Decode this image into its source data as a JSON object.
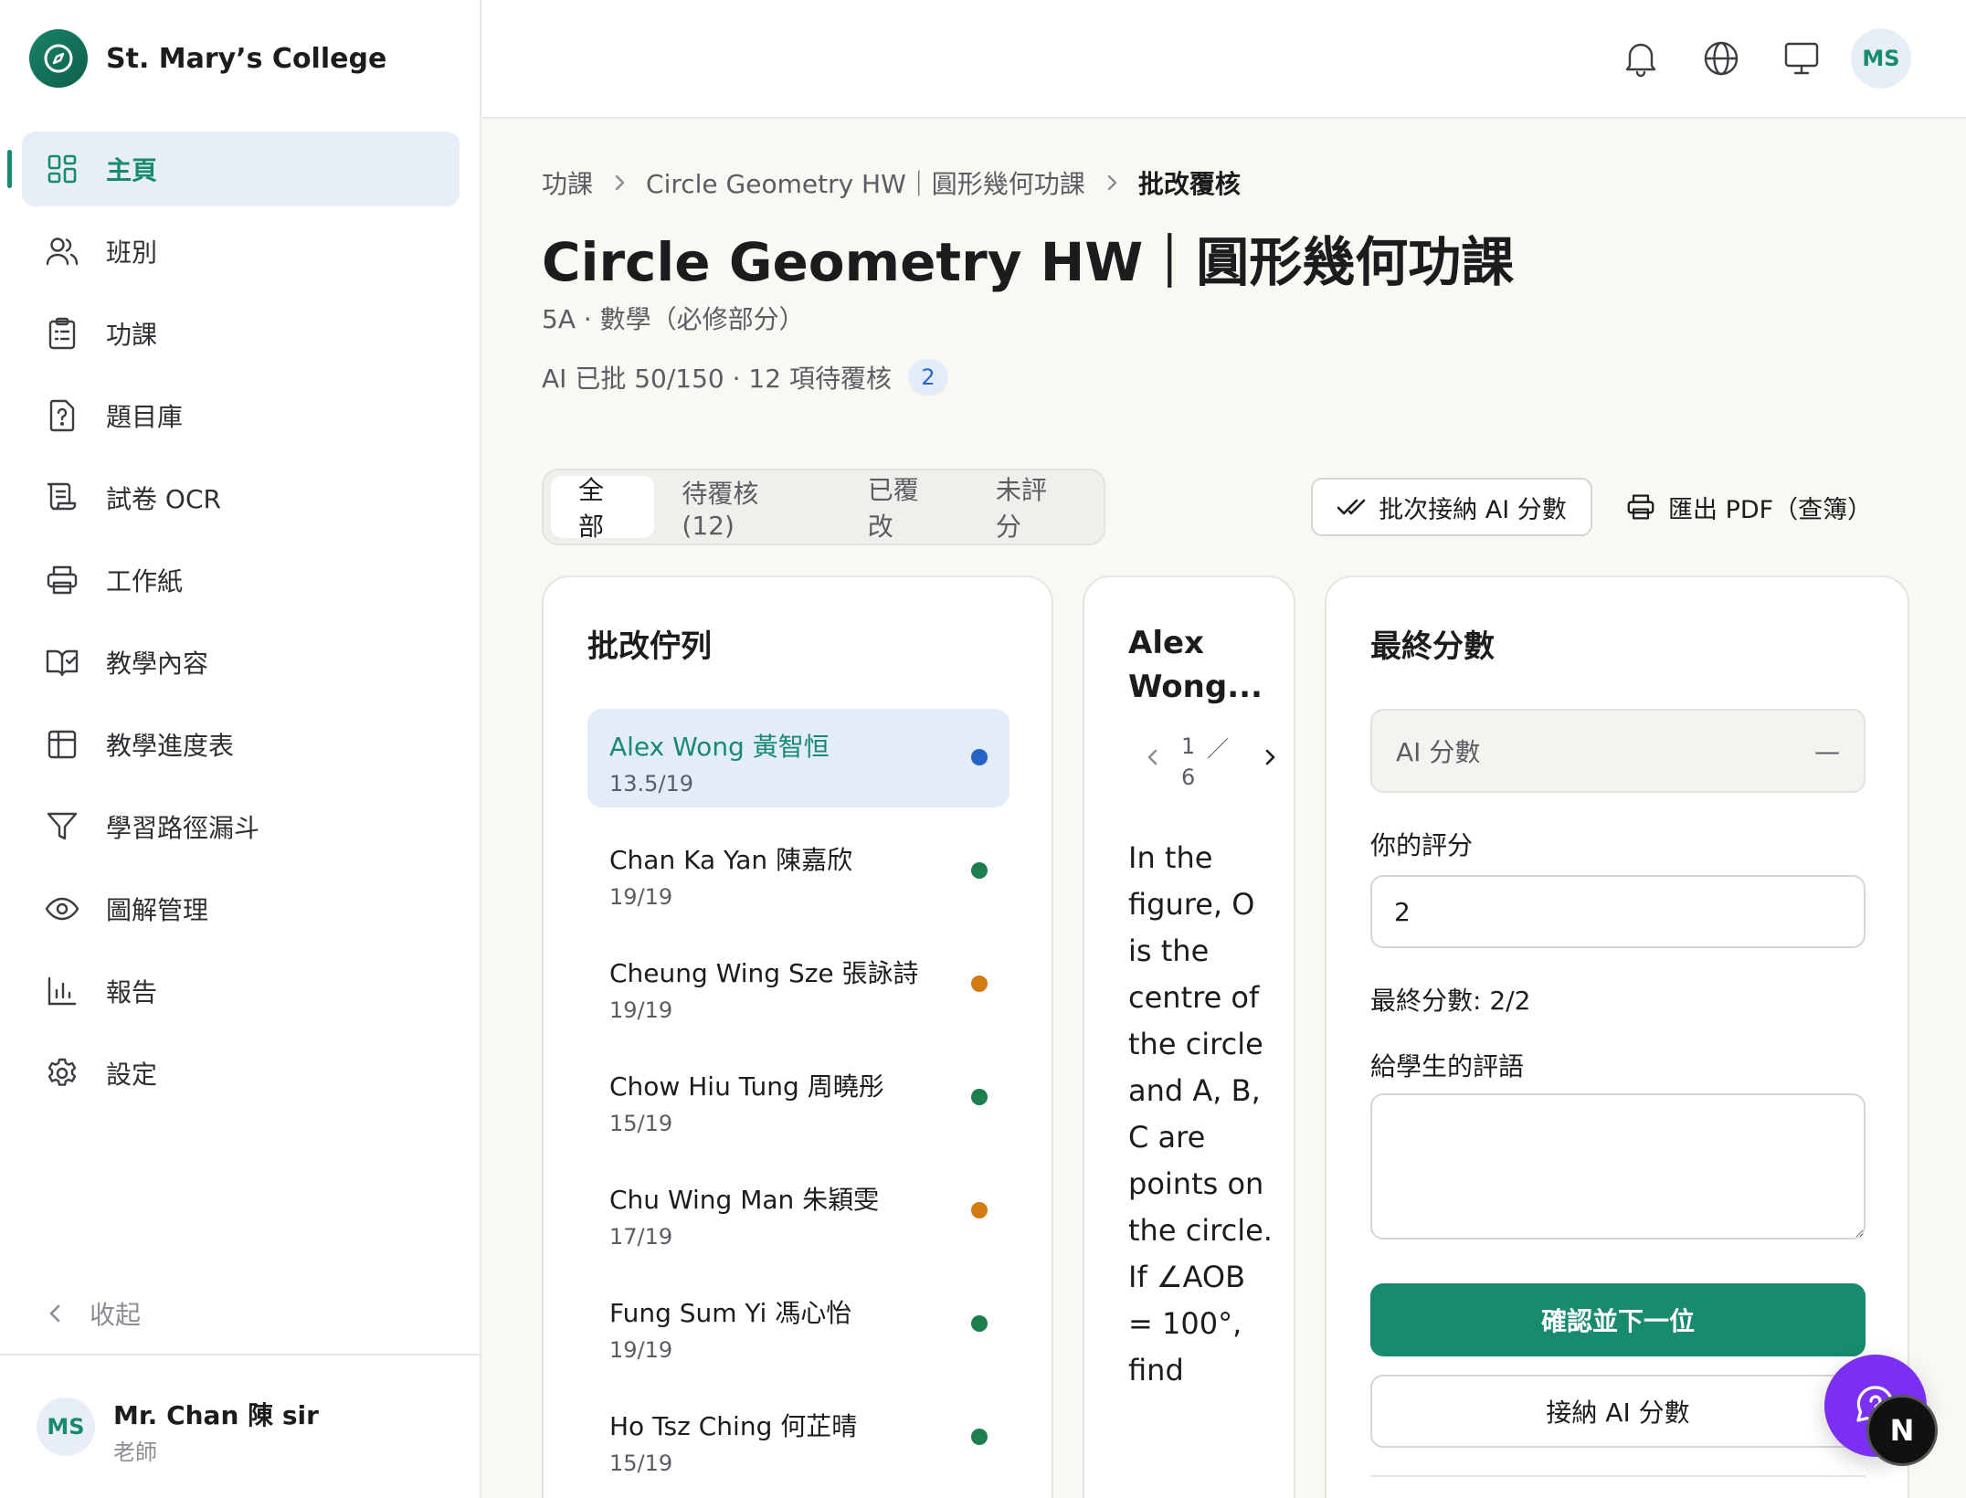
{
  "brand": {
    "name": "St. Mary’s College"
  },
  "sidebar": {
    "items": [
      {
        "label": "主頁",
        "icon": "dashboard-icon",
        "active": true
      },
      {
        "label": "班別",
        "icon": "users-icon"
      },
      {
        "label": "功課",
        "icon": "clipboard-list-icon"
      },
      {
        "label": "題目庫",
        "icon": "question-file-icon"
      },
      {
        "label": "試卷 OCR",
        "icon": "scroll-icon"
      },
      {
        "label": "工作紙",
        "icon": "printer-icon"
      },
      {
        "label": "教學內容",
        "icon": "book-open-check-icon"
      },
      {
        "label": "教學進度表",
        "icon": "table-icon"
      },
      {
        "label": "學習路徑漏斗",
        "icon": "funnel-icon"
      },
      {
        "label": "圖解管理",
        "icon": "eye-icon"
      },
      {
        "label": "報告",
        "icon": "bar-chart-icon"
      },
      {
        "label": "設定",
        "icon": "gear-icon"
      }
    ],
    "collapse_label": "收起"
  },
  "user": {
    "initials": "MS",
    "name": "Mr. Chan 陳 sir",
    "role": "老師"
  },
  "header": {
    "avatar_initials": "MS",
    "icons": [
      "bell-icon",
      "globe-icon",
      "monitor-icon"
    ]
  },
  "breadcrumb": {
    "home": "功課",
    "assignment": "Circle Geometry HW｜圓形幾何功課",
    "current": "批改覆核"
  },
  "page": {
    "title": "Circle Geometry HW｜圓形幾何功課",
    "subtitle": "5A · 數學（必修部分）",
    "progress": "AI 已批 50/150 · 12 項待覆核",
    "badge": "2"
  },
  "tabs": [
    "全部",
    "待覆核 (12)",
    "已覆改",
    "未評分"
  ],
  "actions": {
    "batch_accept": "批次接納 AI 分數",
    "export_pdf": "匯出 PDF（查簿）"
  },
  "queue": {
    "title": "批改佇列",
    "items": [
      {
        "name": "Alex Wong 黃智恒",
        "score": "13.5/19",
        "status_color": "#2563c9",
        "active": true
      },
      {
        "name": "Chan Ka Yan 陳嘉欣",
        "score": "19/19",
        "status_color": "#1e7d4c"
      },
      {
        "name": "Cheung Wing Sze 張詠詩",
        "score": "19/19",
        "status_color": "#d17a12"
      },
      {
        "name": "Chow Hiu Tung 周曉彤",
        "score": "15/19",
        "status_color": "#1e7d4c"
      },
      {
        "name": "Chu Wing Man 朱穎雯",
        "score": "17/19",
        "status_color": "#d17a12"
      },
      {
        "name": "Fung Sum Yi 馮心怡",
        "score": "19/19",
        "status_color": "#1e7d4c"
      },
      {
        "name": "Ho Tsz Ching 何芷晴",
        "score": "15/19",
        "status_color": "#1e7d4c"
      }
    ]
  },
  "question": {
    "student": "Alex Wong...",
    "page_current": "1",
    "page_total": "6",
    "page_sep": "／",
    "text": "In the figure, O is the centre of the circle and A, B, C are points on the circle. If ∠AOB = 100°, find"
  },
  "score_panel": {
    "title": "最終分數",
    "ai_label": "AI 分數",
    "ai_value": "—",
    "your_score_label": "你的評分",
    "your_score_value": "2",
    "final_label": "最終分數: 2/2",
    "comment_label": "給學生的評語",
    "confirm_button": "確認並下一位",
    "accept_button": "接納 AI 分數"
  },
  "colors": {
    "accent": "#178a6f",
    "active_bg": "#e8eef7",
    "fab": "#7b2ff0"
  },
  "fab": {
    "label": "N"
  }
}
